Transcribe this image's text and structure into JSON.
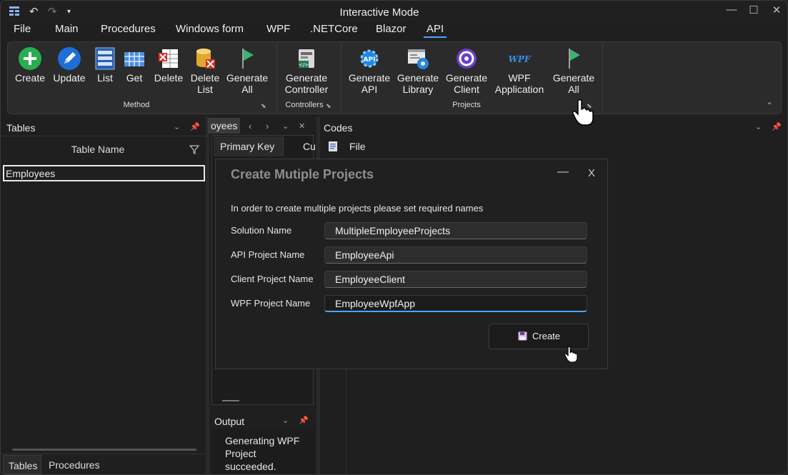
{
  "window": {
    "title": "Interactive Mode"
  },
  "menu": [
    "File",
    "Main",
    "Procedures",
    "Windows form",
    "WPF",
    ".NETCore",
    "Blazor",
    "API"
  ],
  "ribbon": {
    "method_buttons": [
      {
        "label1": "Create",
        "label2": "",
        "icon": "plus-circle-icon"
      },
      {
        "label1": "Update",
        "label2": "",
        "icon": "pencil-icon"
      },
      {
        "label1": "List",
        "label2": "",
        "icon": "list-icon"
      },
      {
        "label1": "Get",
        "label2": "",
        "icon": "grid-icon"
      },
      {
        "label1": "Delete",
        "label2": "",
        "icon": "delete-table-icon"
      },
      {
        "label1": "Delete",
        "label2": "List",
        "icon": "delete-db-icon"
      },
      {
        "label1": "Generate",
        "label2": "All",
        "icon": "flag-icon"
      }
    ],
    "controller_buttons": [
      {
        "label1": "Generate",
        "label2": "Controller",
        "icon": "controller-icon"
      }
    ],
    "project_buttons": [
      {
        "label1": "Generate",
        "label2": "API",
        "icon": "api-icon"
      },
      {
        "label1": "Generate",
        "label2": "Library",
        "icon": "library-icon"
      },
      {
        "label1": "Generate",
        "label2": "Client",
        "icon": "client-icon"
      },
      {
        "label1": "WPF",
        "label2": "Application",
        "icon": "wpf-icon"
      },
      {
        "label1": "Generate",
        "label2": "All",
        "icon": "flag-icon"
      }
    ],
    "groups": {
      "method": "Method",
      "controllers": "Controllers",
      "projects": "Projects"
    },
    "wpf_icon_text": "WPF",
    "api_icon_text": "API"
  },
  "tables_panel": {
    "title": "Tables",
    "column_header": "Table Name",
    "rows": [
      "Employees"
    ],
    "bottom_tabs": [
      "Tables",
      "Procedures"
    ]
  },
  "middle_panel": {
    "tab_title": "oyees",
    "columns": [
      "Primary Key",
      "Cu"
    ]
  },
  "output_panel": {
    "title": "Output",
    "message": "Generating WPF Project succeeded."
  },
  "codes_panel": {
    "title": "Codes",
    "file_label": "File"
  },
  "dialog": {
    "title": "Create Mutiple Projects",
    "close": "X",
    "minimize": "—",
    "instructions": "In order to create multiple projects please set required names",
    "fields": [
      {
        "label": "Solution Name",
        "value": "MultipleEmployeeProjects"
      },
      {
        "label": "API Project Name",
        "value": "EmployeeApi"
      },
      {
        "label": "Client Project Name",
        "value": "EmployeeClient"
      },
      {
        "label": "WPF Project Name",
        "value": "EmployeeWpfApp"
      }
    ],
    "create_label": "Create"
  },
  "colors": {
    "accent": "#4ea6ff",
    "background": "#1f1f1f",
    "ribbon": "#2b2b2b",
    "create_icon": "#27ae4f"
  }
}
